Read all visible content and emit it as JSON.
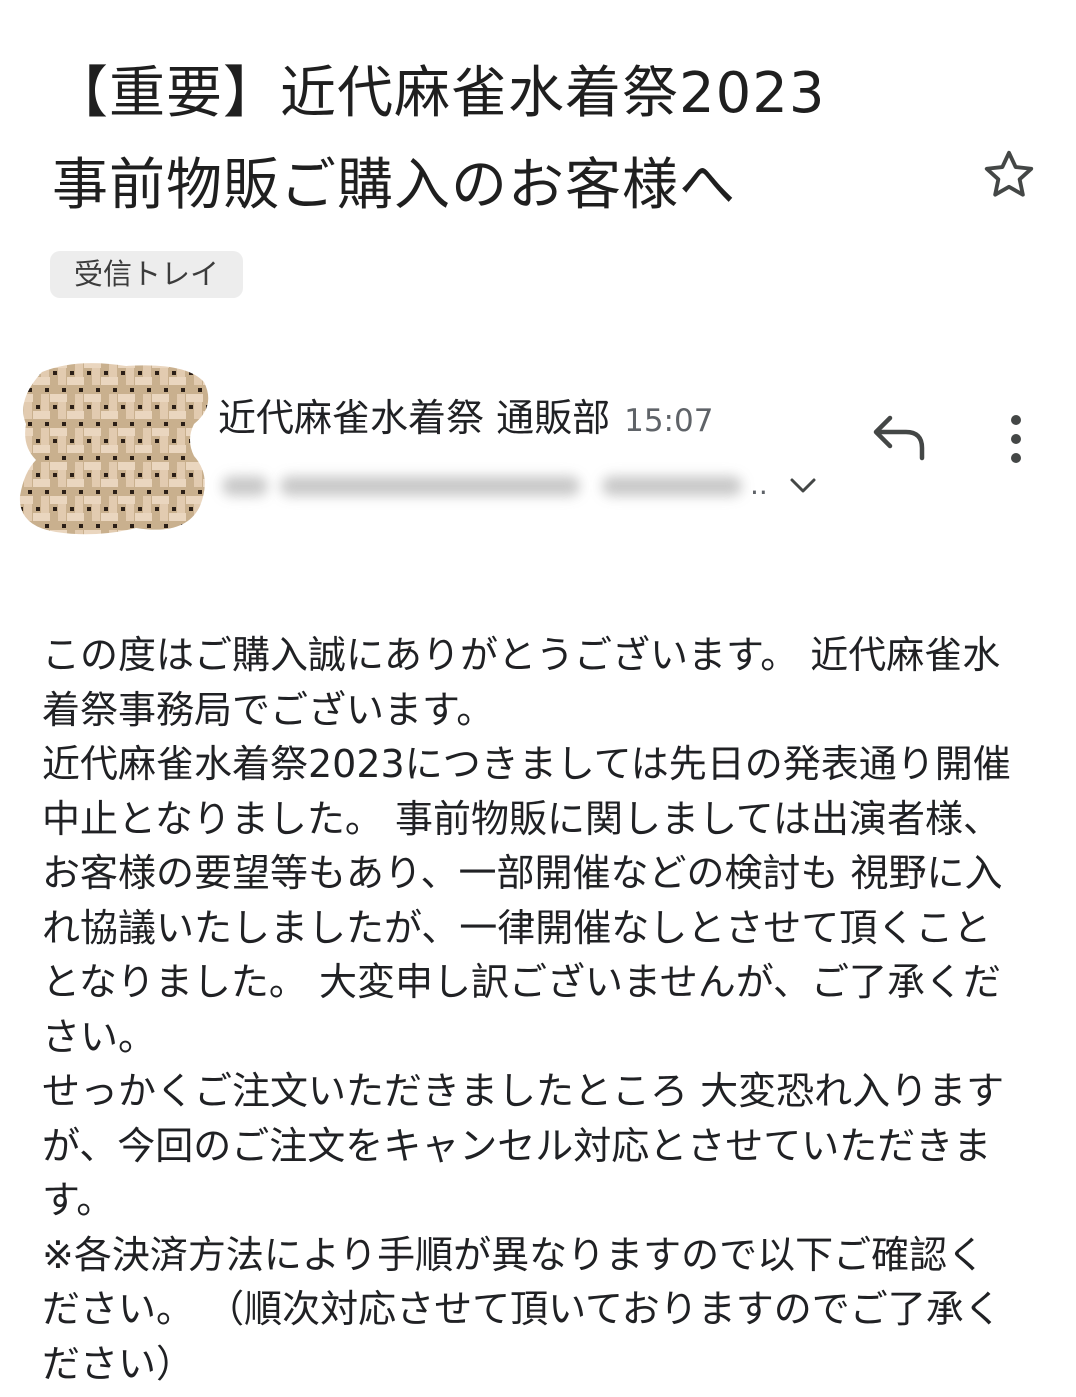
{
  "email": {
    "subject": "【重要】近代麻雀水着祭2023\n事前物販ご購入のお客様へ",
    "label": "受信トレイ",
    "sender_name": "近代麻雀水着祭 通販部",
    "time": "15:07",
    "recipient_ellipsis": "..",
    "body_paragraphs": [
      "この度はご購入誠にありがとうございます。 近代麻雀水着祭事務局でございます。",
      "近代麻雀水着祭2023につきましては先日の発表通り開催中止となりました。 事前物販に関しましては出演者様、お客様の要望等もあり、一部開催などの検討も 視野に入れ協議いたしましたが、一律開催なしとさせて頂くこととなりました。 大変申し訳ございませんが、ご了承ください。",
      "せっかくご注文いただきましたところ 大変恐れ入りますが、今回のご注文をキャンセル対応とさせていただきます。",
      "※各決済方法により手順が異なりますので以下ご確認ください。 （順次対応させて頂いておりますのでご了承ください）"
    ]
  },
  "icons": {
    "star": "star-outline-icon",
    "reply": "reply-icon",
    "more": "more-vertical-icon",
    "expand": "chevron-down-icon"
  },
  "colors": {
    "avatar_base": "#c9b08e",
    "avatar_light": "#ead6bf",
    "avatar_dot": "#2b1f17"
  }
}
